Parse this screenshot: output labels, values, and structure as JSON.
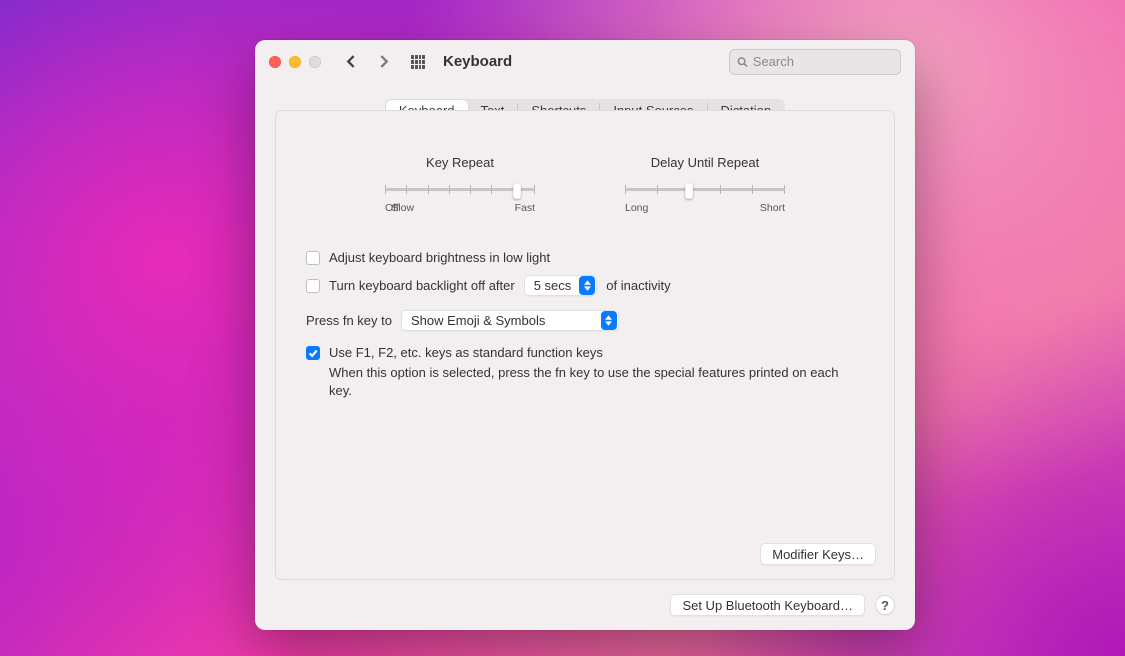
{
  "toolbar": {
    "title": "Keyboard",
    "search_placeholder": "Search"
  },
  "tabs": {
    "items": [
      "Keyboard",
      "Text",
      "Shortcuts",
      "Input Sources",
      "Dictation"
    ],
    "selected_index": 0
  },
  "sliders": {
    "key_repeat": {
      "title": "Key Repeat",
      "left_label": "Off",
      "mid_label": "Slow",
      "right_label": "Fast",
      "tick_count": 8,
      "value_index": 7
    },
    "delay_until_repeat": {
      "title": "Delay Until Repeat",
      "left_label": "Long",
      "right_label": "Short",
      "tick_count": 6,
      "value_index": 2
    }
  },
  "checkboxes": {
    "adjust_brightness": {
      "label": "Adjust keyboard brightness in low light",
      "checked": false
    },
    "backlight_off": {
      "prefix": "Turn keyboard backlight off after",
      "select_value": "5 secs",
      "suffix": "of inactivity",
      "checked": false
    },
    "fn_key": {
      "prefix": "Press fn key to",
      "select_value": "Show Emoji & Symbols"
    },
    "function_keys": {
      "label": "Use F1, F2, etc. keys as standard function keys",
      "help": "When this option is selected, press the fn key to use the special features printed on each key.",
      "checked": true
    }
  },
  "buttons": {
    "modifier_keys": "Modifier Keys…",
    "bluetooth": "Set Up Bluetooth Keyboard…"
  },
  "colors": {
    "accent": "#0a7aff"
  }
}
